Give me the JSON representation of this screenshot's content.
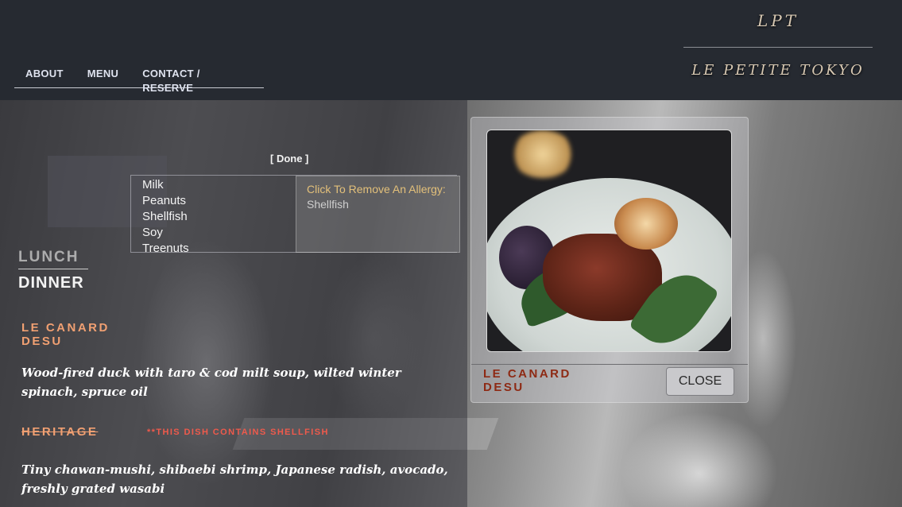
{
  "header": {
    "nav": [
      "ABOUT",
      "MENU",
      "CONTACT / RESERVE"
    ],
    "brand_short": "LPT",
    "brand_full": "LE PETITE TOKYO"
  },
  "allergy": {
    "done_label": "[ Done ]",
    "options": [
      "Milk",
      "Peanuts",
      "Shellfish",
      "Soy",
      "Treenuts"
    ],
    "remove_title": "Click To Remove An Allergy:",
    "selected": [
      "Shellfish"
    ]
  },
  "menu": {
    "meals": [
      "LUNCH",
      "DINNER"
    ],
    "active_meal": "DINNER",
    "dishes": [
      {
        "name": "LE CANARD DESU",
        "description": "Wood-fired duck with taro & cod milt soup, wilted winter spinach, spruce oil"
      },
      {
        "name": "HERITAGE",
        "warning": "**THIS DISH CONTAINS SHELLFISH",
        "description": "Tiny chawan-mushi, shibaebi shrimp, Japanese radish, avocado, freshly grated wasabi"
      }
    ]
  },
  "modal": {
    "title": "LE CANARD DESU",
    "close_label": "CLOSE"
  },
  "colors": {
    "accent": "#f1a072",
    "warning": "#ef5a4c",
    "brand": "#d8c9b3"
  }
}
